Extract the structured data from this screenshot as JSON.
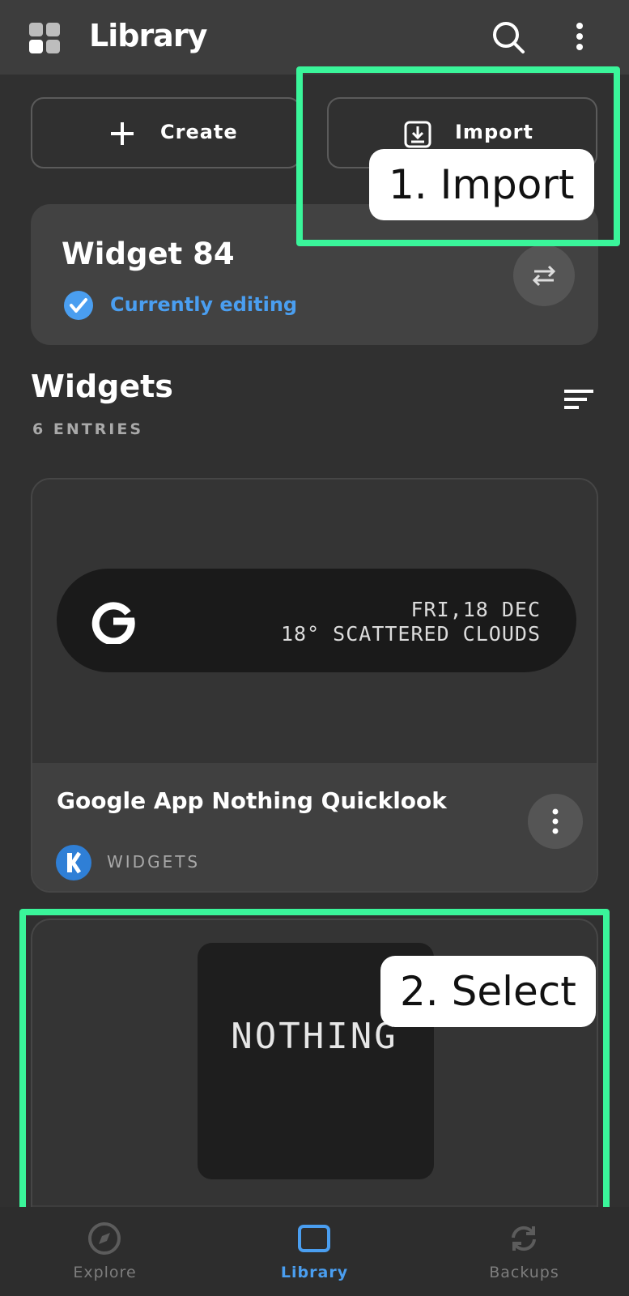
{
  "header": {
    "title": "Library",
    "icons": {
      "logo": "library-logo-icon",
      "search": "search-icon",
      "more": "more-vert-icon"
    }
  },
  "actions": {
    "create_label": "Create",
    "import_label": "Import"
  },
  "current": {
    "name": "Widget 84",
    "status": "Currently editing"
  },
  "section": {
    "title": "Widgets",
    "count": "6 ENTRIES"
  },
  "items": [
    {
      "preview_line1": "FRI,18 DEC",
      "preview_line2": "18° SCATTERED CLOUDS",
      "title": "Google App Nothing Quicklook",
      "category": "WIDGETS"
    },
    {
      "preview_text": "NOTHING"
    }
  ],
  "annotations": {
    "step1": "1. Import",
    "step2": "2. Select",
    "color": "#3af59a"
  },
  "nav": {
    "items": [
      {
        "label": "Explore",
        "icon": "compass-icon"
      },
      {
        "label": "Library",
        "icon": "library-icon"
      },
      {
        "label": "Backups",
        "icon": "sync-icon"
      }
    ],
    "active_color": "#4a9ef0"
  }
}
